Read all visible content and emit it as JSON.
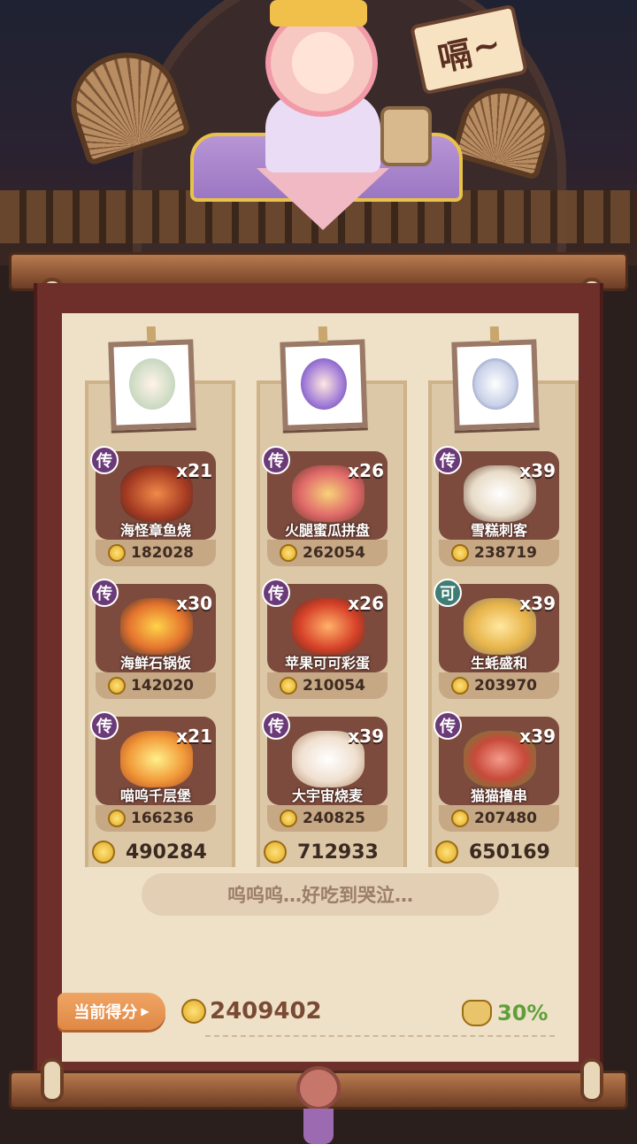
{
  "scene": {
    "sign_text": "嗝",
    "sign_tail": "~"
  },
  "columns": [
    {
      "portrait_icon": "elf-warrior-portrait-icon",
      "dishes": [
        {
          "badge": "传",
          "badge_color": "#6b3a78",
          "count": "x21",
          "name": "海怪章鱼烧",
          "coins": "182028",
          "food_icon": "octopus-stew-icon"
        },
        {
          "badge": "传",
          "badge_color": "#6b3a78",
          "count": "x30",
          "name": "海鲜石锅饭",
          "coins": "142020",
          "food_icon": "seafood-stone-pot-rice-icon"
        },
        {
          "badge": "传",
          "badge_color": "#6b3a78",
          "count": "x21",
          "name": "喵呜千层堡",
          "coins": "166236",
          "food_icon": "layered-burger-icon"
        }
      ],
      "total": "490284"
    },
    {
      "portrait_icon": "purple-mage-portrait-icon",
      "dishes": [
        {
          "badge": "传",
          "badge_color": "#6b3a78",
          "count": "x26",
          "name": "火腿蜜瓜拼盘",
          "coins": "262054",
          "food_icon": "ham-melon-platter-icon"
        },
        {
          "badge": "传",
          "badge_color": "#6b3a78",
          "count": "x26",
          "name": "苹果可可彩蛋",
          "coins": "210054",
          "food_icon": "apple-cocoa-egg-icon"
        },
        {
          "badge": "传",
          "badge_color": "#6b3a78",
          "count": "x39",
          "name": "大宇宙烧麦",
          "coins": "240825",
          "food_icon": "shaomai-dumpling-icon"
        }
      ],
      "total": "712933"
    },
    {
      "portrait_icon": "silver-hair-portrait-icon",
      "dishes": [
        {
          "badge": "传",
          "badge_color": "#6b3a78",
          "count": "x39",
          "name": "雪糕刺客",
          "coins": "238719",
          "food_icon": "ice-cream-assassin-icon"
        },
        {
          "badge": "可",
          "badge_color": "#3f7c74",
          "count": "x39",
          "name": "生蚝盛和",
          "coins": "203970",
          "food_icon": "oyster-platter-icon"
        },
        {
          "badge": "传",
          "badge_color": "#6b3a78",
          "count": "x39",
          "name": "猫猫撸串",
          "coins": "207480",
          "food_icon": "meat-skewers-icon"
        }
      ],
      "total": "650169"
    }
  ],
  "bubble_text": "呜呜呜…好吃到哭泣…",
  "score": {
    "label": "当前得分",
    "value": "2409402",
    "bonus_percent": "30%"
  },
  "colors": {
    "accent_orange": "#e08845",
    "bonus_green": "#5ea03a",
    "card_brown": "#7c4b3e"
  }
}
